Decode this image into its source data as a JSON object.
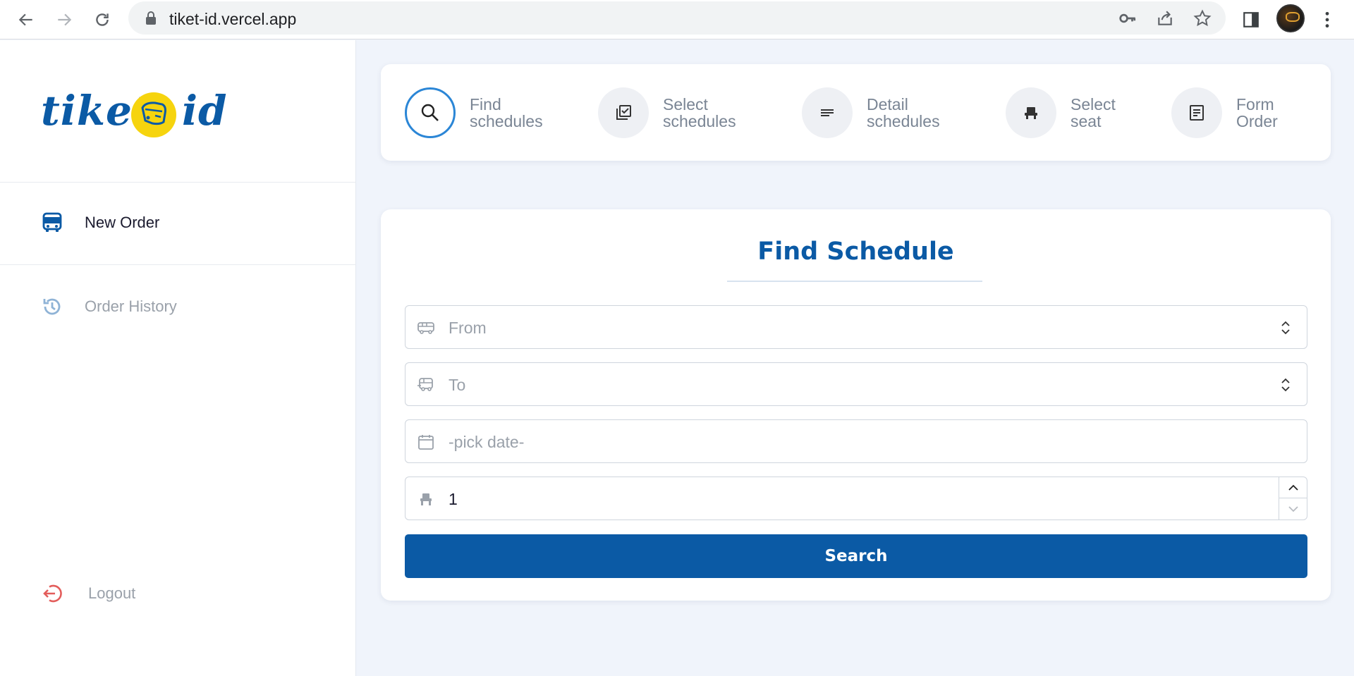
{
  "browser": {
    "url": "tiket-id.vercel.app"
  },
  "sidebar": {
    "logo": {
      "left_text": "tiket",
      "right_text": "id"
    },
    "items": [
      {
        "label": "New Order",
        "icon": "bus-icon",
        "color": "#1a1a2e"
      },
      {
        "label": "Order History",
        "icon": "history-icon",
        "color": "#9aa1aa"
      }
    ],
    "logout_label": "Logout"
  },
  "stepper": {
    "steps": [
      {
        "label_line1": "Find",
        "label_line2": "schedules",
        "icon": "search-icon",
        "active": true
      },
      {
        "label_line1": "Select",
        "label_line2": "schedules",
        "icon": "checkbox-icon",
        "active": false
      },
      {
        "label_line1": "Detail",
        "label_line2": "schedules",
        "icon": "lines-icon",
        "active": false
      },
      {
        "label_line1": "Select",
        "label_line2": "seat",
        "icon": "seat-icon",
        "active": false
      },
      {
        "label_line1": "Form",
        "label_line2": "Order",
        "icon": "form-icon",
        "active": false
      }
    ]
  },
  "form": {
    "title": "Find Schedule",
    "from_placeholder": "From",
    "to_placeholder": "To",
    "date_placeholder": "-pick date-",
    "seats_value": "1",
    "search_label": "Search"
  },
  "colors": {
    "primary": "#0b5aa5",
    "accent_active": "#2b86d6",
    "logo_yellow": "#f6d40e",
    "logout_red": "#e35d5b"
  }
}
